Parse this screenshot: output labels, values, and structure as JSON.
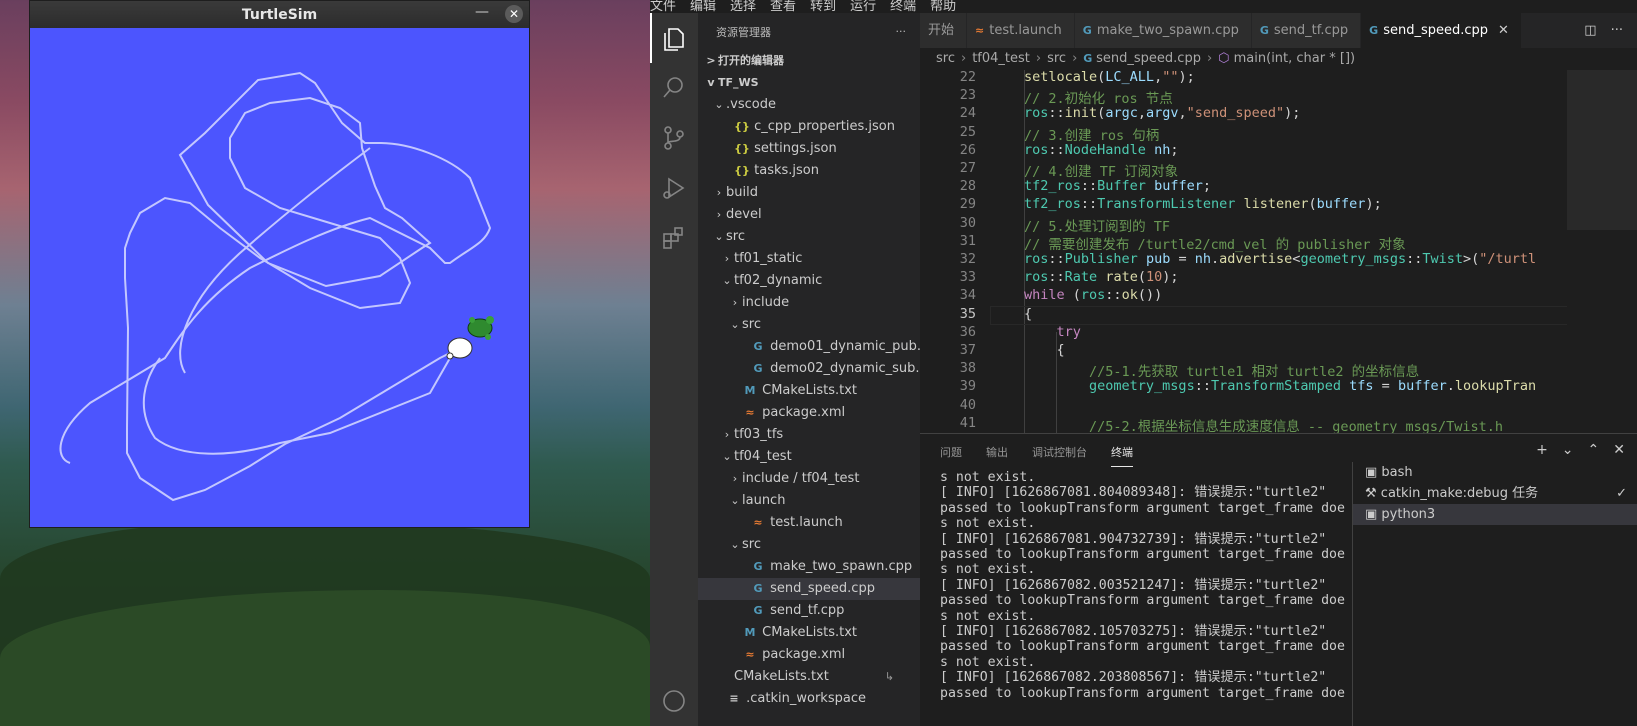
{
  "turtlesim": {
    "title": "TurtleSim",
    "min": "—",
    "close": "✕"
  },
  "menubar": [
    "文件",
    "编辑",
    "选择",
    "查看",
    "转到",
    "运行",
    "终端",
    "帮助"
  ],
  "sidebar": {
    "title": "资源管理器",
    "more": "···",
    "open_editors": "打开的编辑器",
    "workspace": "TF_WS",
    "items": [
      {
        "label": ".vscode",
        "depth": 1,
        "chev": "v",
        "icon": ""
      },
      {
        "label": "c_cpp_properties.json",
        "depth": 2,
        "chev": "",
        "icon": "{}",
        "color": "#cbcb41"
      },
      {
        "label": "settings.json",
        "depth": 2,
        "chev": "",
        "icon": "{}",
        "color": "#cbcb41"
      },
      {
        "label": "tasks.json",
        "depth": 2,
        "chev": "",
        "icon": "{}",
        "color": "#cbcb41"
      },
      {
        "label": "build",
        "depth": 1,
        "chev": ">",
        "icon": ""
      },
      {
        "label": "devel",
        "depth": 1,
        "chev": ">",
        "icon": ""
      },
      {
        "label": "src",
        "depth": 1,
        "chev": "v",
        "icon": ""
      },
      {
        "label": "tf01_static",
        "depth": 2,
        "chev": ">",
        "icon": ""
      },
      {
        "label": "tf02_dynamic",
        "depth": 2,
        "chev": "v",
        "icon": ""
      },
      {
        "label": "include",
        "depth": 3,
        "chev": ">",
        "icon": ""
      },
      {
        "label": "src",
        "depth": 3,
        "chev": "v",
        "icon": ""
      },
      {
        "label": "demo01_dynamic_pub.cpp",
        "depth": 4,
        "chev": "",
        "icon": "G",
        "color": "#519aba"
      },
      {
        "label": "demo02_dynamic_sub.cpp",
        "depth": 4,
        "chev": "",
        "icon": "G",
        "color": "#519aba"
      },
      {
        "label": "CMakeLists.txt",
        "depth": 3,
        "chev": "",
        "icon": "M",
        "color": "#519aba"
      },
      {
        "label": "package.xml",
        "depth": 3,
        "chev": "",
        "icon": "≈",
        "color": "#e37933"
      },
      {
        "label": "tf03_tfs",
        "depth": 2,
        "chev": ">",
        "icon": ""
      },
      {
        "label": "tf04_test",
        "depth": 2,
        "chev": "v",
        "icon": ""
      },
      {
        "label": "include / tf04_test",
        "depth": 3,
        "chev": ">",
        "icon": ""
      },
      {
        "label": "launch",
        "depth": 3,
        "chev": "v",
        "icon": ""
      },
      {
        "label": "test.launch",
        "depth": 4,
        "chev": "",
        "icon": "≈",
        "color": "#e37933"
      },
      {
        "label": "src",
        "depth": 3,
        "chev": "v",
        "icon": ""
      },
      {
        "label": "make_two_spawn.cpp",
        "depth": 4,
        "chev": "",
        "icon": "G",
        "color": "#519aba"
      },
      {
        "label": "send_speed.cpp",
        "depth": 4,
        "chev": "",
        "icon": "G",
        "color": "#519aba",
        "selected": true
      },
      {
        "label": "send_tf.cpp",
        "depth": 4,
        "chev": "",
        "icon": "G",
        "color": "#519aba"
      },
      {
        "label": "CMakeLists.txt",
        "depth": 3,
        "chev": "",
        "icon": "M",
        "color": "#519aba"
      },
      {
        "label": "package.xml",
        "depth": 3,
        "chev": "",
        "icon": "≈",
        "color": "#e37933"
      },
      {
        "label": "CMakeLists.txt",
        "depth": 2,
        "chev": "",
        "icon": "",
        "badge": "↳"
      },
      {
        "label": ".catkin_workspace",
        "depth": 1,
        "chev": "",
        "icon": "≡",
        "color": "#ccc"
      }
    ]
  },
  "tabs": [
    {
      "label": "开始",
      "icon": "",
      "active": false
    },
    {
      "label": "test.launch",
      "icon": "≈",
      "color": "#e37933",
      "active": false
    },
    {
      "label": "make_two_spawn.cpp",
      "icon": "G",
      "color": "#519aba",
      "active": false
    },
    {
      "label": "send_tf.cpp",
      "icon": "G",
      "color": "#519aba",
      "active": false
    },
    {
      "label": "send_speed.cpp",
      "icon": "G",
      "color": "#519aba",
      "active": true
    }
  ],
  "breadcrumb": [
    "src",
    "tf04_test",
    "src",
    "send_speed.cpp",
    "main(int, char * [])"
  ],
  "code": {
    "current_line": 35,
    "lines": [
      {
        "n": "22",
        "html": "<span class='f'>setlocale</span>(<span class='v'>LC_ALL</span>,<span class='s'>\"\"</span>);"
      },
      {
        "n": "23",
        "html": "<span class='c'>// 2.初始化 ros 节点</span>"
      },
      {
        "n": "24",
        "html": "<span class='t'>ros</span>::<span class='f'>init</span>(<span class='v'>argc</span>,<span class='v'>argv</span>,<span class='s'>\"send_speed\"</span>);"
      },
      {
        "n": "25",
        "html": "<span class='c'>// 3.创建 ros 句柄</span>"
      },
      {
        "n": "26",
        "html": "<span class='t'>ros</span>::<span class='t'>NodeHandle</span> <span class='v'>nh</span>;"
      },
      {
        "n": "27",
        "html": "<span class='c'>// 4.创建 TF 订阅对象</span>"
      },
      {
        "n": "28",
        "html": "<span class='t'>tf2_ros</span>::<span class='t'>Buffer</span> <span class='v'>buffer</span>;"
      },
      {
        "n": "29",
        "html": "<span class='t'>tf2_ros</span>::<span class='t'>TransformListener</span> <span class='f'>listener</span>(<span class='v'>buffer</span>);"
      },
      {
        "n": "30",
        "html": "<span class='c'>// 5.处理订阅到的 TF</span>"
      },
      {
        "n": "31",
        "html": "<span class='c'>// 需要创建发布 /turtle2/cmd_vel 的 publisher 对象</span>"
      },
      {
        "n": "32",
        "html": "<span class='t'>ros</span>::<span class='t'>Publisher</span> <span class='v'>pub</span> = <span class='v'>nh</span>.<span class='f'>advertise</span>&lt;<span class='t'>geometry_msgs</span>::<span class='t'>Twist</span>&gt;(<span class='s'>\"/turtl</span>"
      },
      {
        "n": "33",
        "html": "<span class='t'>ros</span>::<span class='t'>Rate</span> <span class='f'>rate</span>(<span class='s'>10</span>);"
      },
      {
        "n": "34",
        "html": "<span class='kw'>while</span> (<span class='t'>ros</span>::<span class='f'>ok</span>())"
      },
      {
        "n": "35",
        "html": "{"
      },
      {
        "n": "36",
        "html": "    <span class='kw'>try</span>"
      },
      {
        "n": "37",
        "html": "    {"
      },
      {
        "n": "38",
        "html": "        <span class='c'>//5-1.先获取 turtle1 相对 turtle2 的坐标信息</span>"
      },
      {
        "n": "39",
        "html": "        <span class='t'>geometry_msgs</span>::<span class='t'>TransformStamped</span> <span class='v'>tfs</span> = <span class='v'>buffer</span>.<span class='f'>lookupTran</span>"
      },
      {
        "n": "40",
        "html": ""
      },
      {
        "n": "41",
        "html": "        <span class='c'>//5-2.根据坐标信息生成速度信息 -- geometry_msgs/Twist.h</span>"
      }
    ]
  },
  "panel": {
    "tabs": [
      "问题",
      "输出",
      "调试控制台",
      "终端"
    ],
    "active_tab": "终端",
    "terminal_lines": [
      "s not exist.",
      "[ INFO] [1626867081.804089348]: 错误提示:\"turtle2\"",
      "passed to lookupTransform argument target_frame doe",
      "s not exist.",
      "[ INFO] [1626867081.904732739]: 错误提示:\"turtle2\"",
      "passed to lookupTransform argument target_frame doe",
      "s not exist.",
      "[ INFO] [1626867082.003521247]: 错误提示:\"turtle2\"",
      "passed to lookupTransform argument target_frame doe",
      "s not exist.",
      "[ INFO] [1626867082.105703275]: 错误提示:\"turtle2\"",
      "passed to lookupTransform argument target_frame doe",
      "s not exist.",
      "[ INFO] [1626867082.203808567]: 错误提示:\"turtle2\"",
      "passed to lookupTransform argument target_frame doe"
    ],
    "terminals": [
      {
        "label": "bash",
        "icon": "▣"
      },
      {
        "label": "catkin_make:debug 任务",
        "icon": "⚒",
        "check": "✓"
      },
      {
        "label": "python3",
        "icon": "▣",
        "selected": true
      }
    ]
  },
  "colors": {
    "turtlesim_bg": "#4c55fe",
    "trail": "#c3c7ff",
    "accent": "#007acc"
  }
}
